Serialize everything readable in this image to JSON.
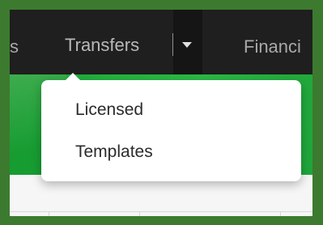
{
  "navbar": {
    "partial_left_label": "s",
    "transfers_label": "Transfers",
    "financials_label": "Financi",
    "caret_icon": "chevron-down-icon"
  },
  "dropdown": {
    "items": [
      {
        "label": "Licensed"
      },
      {
        "label": "Templates"
      }
    ]
  },
  "colors": {
    "frame_border": "#3c7a2f",
    "navbar_bg": "#1f1f1f",
    "banner_green": "#23b33f",
    "menu_bg": "#ffffff"
  }
}
